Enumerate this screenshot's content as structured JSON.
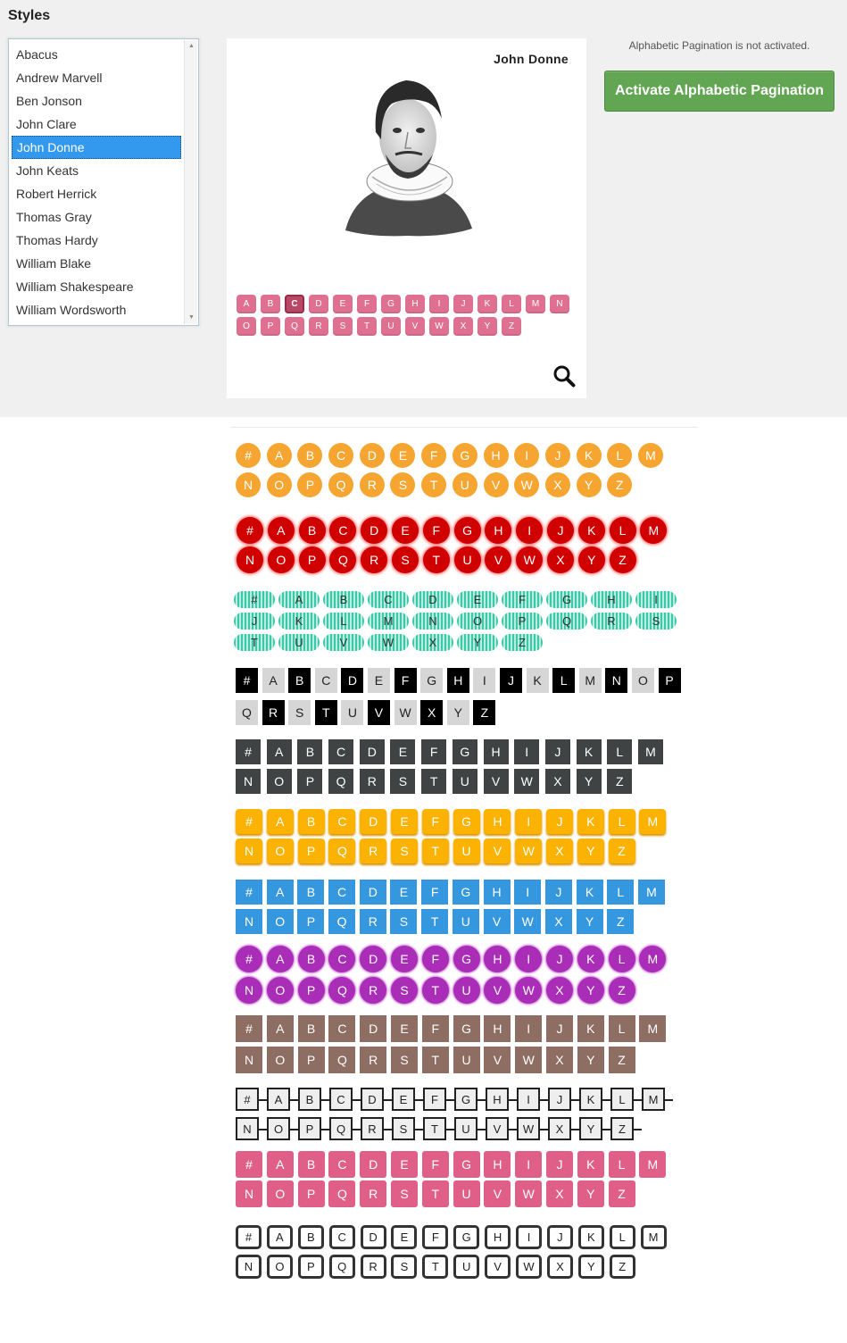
{
  "panel": {
    "heading": "Styles",
    "styles_list": [
      "Abacus",
      "Andrew Marvell",
      "Ben Jonson",
      "John Clare",
      "John Donne",
      "John Keats",
      "Robert Herrick",
      "Thomas Gray",
      "Thomas Hardy",
      "William Blake",
      "William Shakespeare",
      "William Wordsworth"
    ],
    "selected_style": "John Donne"
  },
  "preview": {
    "name": "John Donne",
    "letters": [
      "A",
      "B",
      "C",
      "D",
      "E",
      "F",
      "G",
      "H",
      "I",
      "J",
      "K",
      "L",
      "M",
      "N",
      "O",
      "P",
      "Q",
      "R",
      "S",
      "T",
      "U",
      "V",
      "W",
      "X",
      "Y",
      "Z"
    ],
    "active_letter": "C"
  },
  "activation": {
    "status": "Alphabetic Pagination is not activated.",
    "button_label": "Activate Alphabetic Pagination"
  },
  "demo_letters": [
    "#",
    "A",
    "B",
    "C",
    "D",
    "E",
    "F",
    "G",
    "H",
    "I",
    "J",
    "K",
    "L",
    "M",
    "N",
    "O",
    "P",
    "Q",
    "R",
    "S",
    "T",
    "U",
    "V",
    "W",
    "X",
    "Y",
    "Z"
  ],
  "demo_styles": [
    {
      "id": "s1",
      "color": "#f7a531"
    },
    {
      "id": "s2",
      "color": "#d10000"
    },
    {
      "id": "s3",
      "color": "#3cc7a9"
    },
    {
      "id": "s4",
      "color": "#000000"
    },
    {
      "id": "s5",
      "color": "#3f4344"
    },
    {
      "id": "s6",
      "color": "#fbb200"
    },
    {
      "id": "s7",
      "color": "#3597dd"
    },
    {
      "id": "s8",
      "color": "#aa2db8"
    },
    {
      "id": "s9",
      "color": "#8e6d62"
    },
    {
      "id": "s10",
      "color": "#eeeeee"
    },
    {
      "id": "s11",
      "color": "#e05f88"
    },
    {
      "id": "s12",
      "color": "#333333"
    }
  ]
}
